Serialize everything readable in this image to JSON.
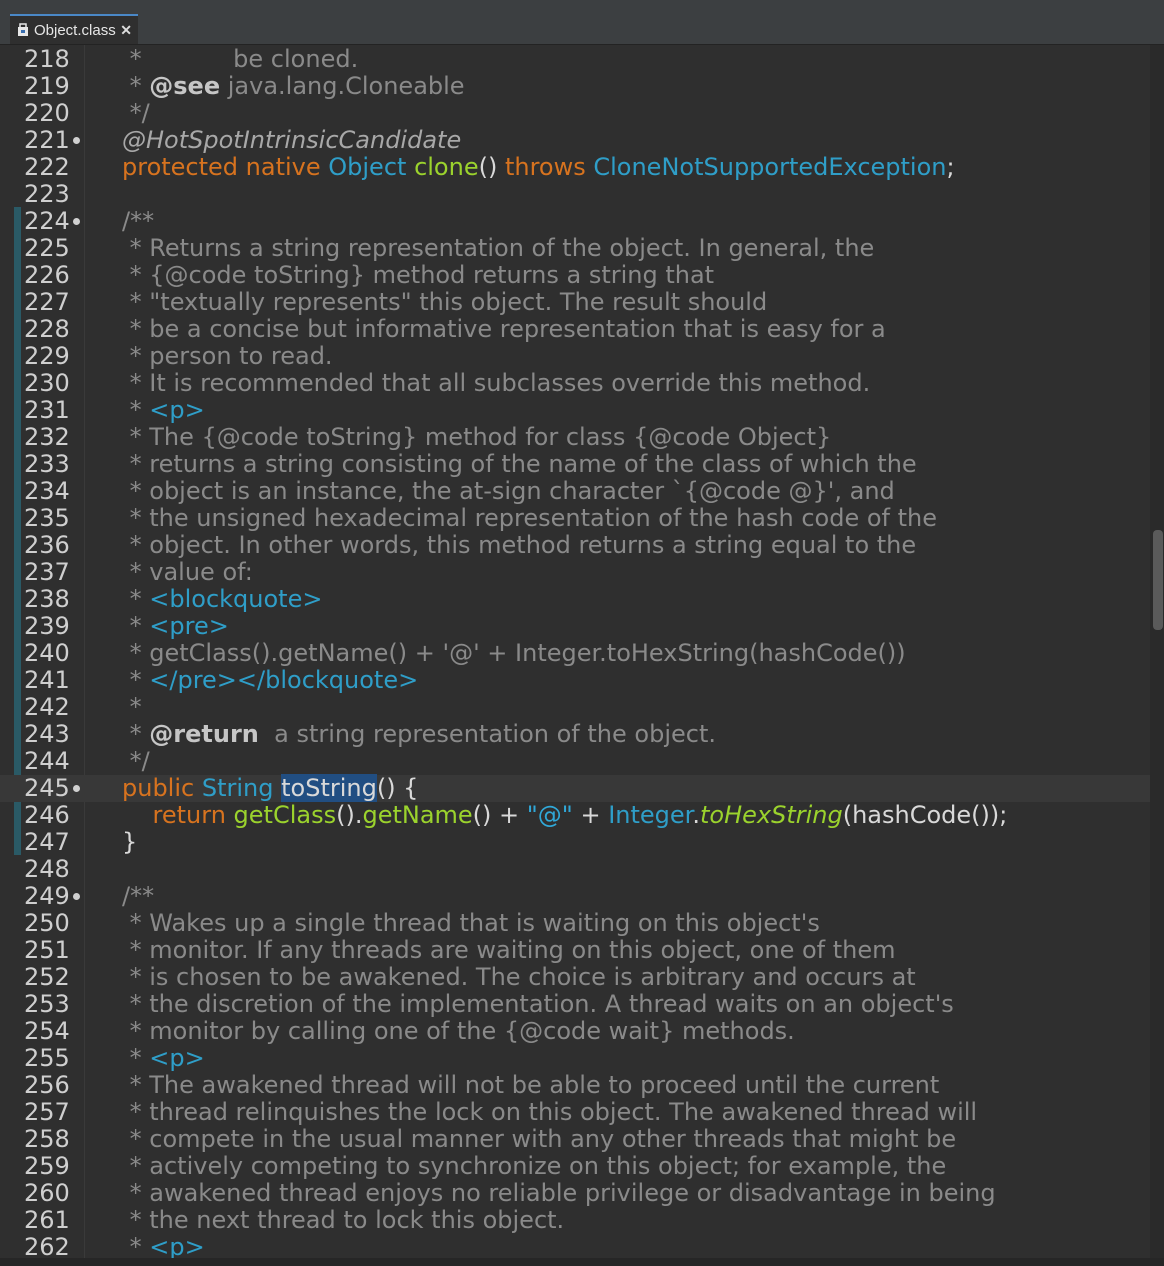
{
  "tab": {
    "label": "Object.class",
    "icon": "class-file-icon",
    "close": "✕"
  },
  "colors": {
    "background": "#2f2f2f",
    "keyword": "#d7731f",
    "type": "#2f9ec8",
    "method": "#9bd32d",
    "comment": "#8a8a8a",
    "selection": "#214e82"
  },
  "current_line": 245,
  "lines": [
    {
      "n": "218",
      "t": [
        [
          "cm",
          " *            be cloned."
        ]
      ]
    },
    {
      "n": "219",
      "t": [
        [
          "cm",
          " * "
        ],
        [
          "cmtag",
          "@see"
        ],
        [
          "cm",
          " java.lang.Cloneable"
        ]
      ]
    },
    {
      "n": "220",
      "t": [
        [
          "cm",
          " */"
        ]
      ]
    },
    {
      "n": "221",
      "fold": true,
      "t": [
        [
          "ann",
          "@HotSpotIntrinsicCandidate"
        ]
      ]
    },
    {
      "n": "222",
      "t": [
        [
          "kw",
          "protected native "
        ],
        [
          "ty",
          "Object "
        ],
        [
          "mth",
          "clone"
        ],
        [
          "plain",
          "() "
        ],
        [
          "kw",
          "throws "
        ],
        [
          "ty",
          "CloneNotSupportedException"
        ],
        [
          "plain",
          ";"
        ]
      ]
    },
    {
      "n": "223",
      "t": []
    },
    {
      "n": "224",
      "fold": true,
      "t": [
        [
          "cm",
          "/**"
        ]
      ]
    },
    {
      "n": "225",
      "t": [
        [
          "cm",
          " * Returns a string representation of the object. In general, the"
        ]
      ]
    },
    {
      "n": "226",
      "t": [
        [
          "cm",
          " * {@code toString} method returns a string that"
        ]
      ]
    },
    {
      "n": "227",
      "t": [
        [
          "cm",
          " * \"textually represents\" this object. The result should"
        ]
      ]
    },
    {
      "n": "228",
      "t": [
        [
          "cm",
          " * be a concise but informative representation that is easy for a"
        ]
      ]
    },
    {
      "n": "229",
      "t": [
        [
          "cm",
          " * person to read."
        ]
      ]
    },
    {
      "n": "230",
      "t": [
        [
          "cm",
          " * It is recommended that all subclasses override this method."
        ]
      ]
    },
    {
      "n": "231",
      "t": [
        [
          "cm",
          " * "
        ],
        [
          "html",
          "<p>"
        ]
      ]
    },
    {
      "n": "232",
      "t": [
        [
          "cm",
          " * The {@code toString} method for class {@code Object}"
        ]
      ]
    },
    {
      "n": "233",
      "t": [
        [
          "cm",
          " * returns a string consisting of the name of the class of which the"
        ]
      ]
    },
    {
      "n": "234",
      "t": [
        [
          "cm",
          " * object is an instance, the at-sign character `{@code @}', and"
        ]
      ]
    },
    {
      "n": "235",
      "t": [
        [
          "cm",
          " * the unsigned hexadecimal representation of the hash code of the"
        ]
      ]
    },
    {
      "n": "236",
      "t": [
        [
          "cm",
          " * object. In other words, this method returns a string equal to the"
        ]
      ]
    },
    {
      "n": "237",
      "t": [
        [
          "cm",
          " * value of:"
        ]
      ]
    },
    {
      "n": "238",
      "t": [
        [
          "cm",
          " * "
        ],
        [
          "html",
          "<blockquote>"
        ]
      ]
    },
    {
      "n": "239",
      "t": [
        [
          "cm",
          " * "
        ],
        [
          "html",
          "<pre>"
        ]
      ]
    },
    {
      "n": "240",
      "t": [
        [
          "cm",
          " * getClass().getName() + '@' + Integer.toHexString(hashCode())"
        ]
      ]
    },
    {
      "n": "241",
      "t": [
        [
          "cm",
          " * "
        ],
        [
          "html",
          "</pre></blockquote>"
        ]
      ]
    },
    {
      "n": "242",
      "t": [
        [
          "cm",
          " *"
        ]
      ]
    },
    {
      "n": "243",
      "t": [
        [
          "cm",
          " * "
        ],
        [
          "cmtag",
          "@return"
        ],
        [
          "cm",
          "  a string representation of the object."
        ]
      ]
    },
    {
      "n": "244",
      "t": [
        [
          "cm",
          " */"
        ]
      ]
    },
    {
      "n": "245",
      "fold": true,
      "t": [
        [
          "kw",
          "public "
        ],
        [
          "ty",
          "String "
        ],
        [
          "sel",
          "toString"
        ],
        [
          "plain",
          "() {"
        ]
      ]
    },
    {
      "n": "246",
      "t": [
        [
          "plain",
          "    "
        ],
        [
          "kw",
          "return "
        ],
        [
          "mth",
          "getClass"
        ],
        [
          "plain",
          "()."
        ],
        [
          "mth",
          "getName"
        ],
        [
          "plain",
          "() + "
        ],
        [
          "str",
          "\"@\""
        ],
        [
          "plain",
          " + "
        ],
        [
          "ty",
          "Integer"
        ],
        [
          "plain",
          "."
        ],
        [
          "ital mth",
          "toHexString"
        ],
        [
          "plain",
          "(hashCode());"
        ]
      ]
    },
    {
      "n": "247",
      "t": [
        [
          "plain",
          "}"
        ]
      ]
    },
    {
      "n": "248",
      "t": []
    },
    {
      "n": "249",
      "fold": true,
      "t": [
        [
          "cm",
          "/**"
        ]
      ]
    },
    {
      "n": "250",
      "t": [
        [
          "cm",
          " * Wakes up a single thread that is waiting on this object's"
        ]
      ]
    },
    {
      "n": "251",
      "t": [
        [
          "cm",
          " * monitor. If any threads are waiting on this object, one of them"
        ]
      ]
    },
    {
      "n": "252",
      "t": [
        [
          "cm",
          " * is chosen to be awakened. The choice is arbitrary and occurs at"
        ]
      ]
    },
    {
      "n": "253",
      "t": [
        [
          "cm",
          " * the discretion of the implementation. A thread waits on an object's"
        ]
      ]
    },
    {
      "n": "254",
      "t": [
        [
          "cm",
          " * monitor by calling one of the {@code wait} methods."
        ]
      ]
    },
    {
      "n": "255",
      "t": [
        [
          "cm",
          " * "
        ],
        [
          "html",
          "<p>"
        ]
      ]
    },
    {
      "n": "256",
      "t": [
        [
          "cm",
          " * The awakened thread will not be able to proceed until the current"
        ]
      ]
    },
    {
      "n": "257",
      "t": [
        [
          "cm",
          " * thread relinquishes the lock on this object. The awakened thread will"
        ]
      ]
    },
    {
      "n": "258",
      "t": [
        [
          "cm",
          " * compete in the usual manner with any other threads that might be"
        ]
      ]
    },
    {
      "n": "259",
      "t": [
        [
          "cm",
          " * actively competing to synchronize on this object; for example, the"
        ]
      ]
    },
    {
      "n": "260",
      "t": [
        [
          "cm",
          " * awakened thread enjoys no reliable privilege or disadvantage in being"
        ]
      ]
    },
    {
      "n": "261",
      "t": [
        [
          "cm",
          " * the next thread to lock this object."
        ]
      ]
    },
    {
      "n": "262",
      "t": [
        [
          "cm",
          " * "
        ],
        [
          "html",
          "<p>"
        ]
      ]
    }
  ]
}
